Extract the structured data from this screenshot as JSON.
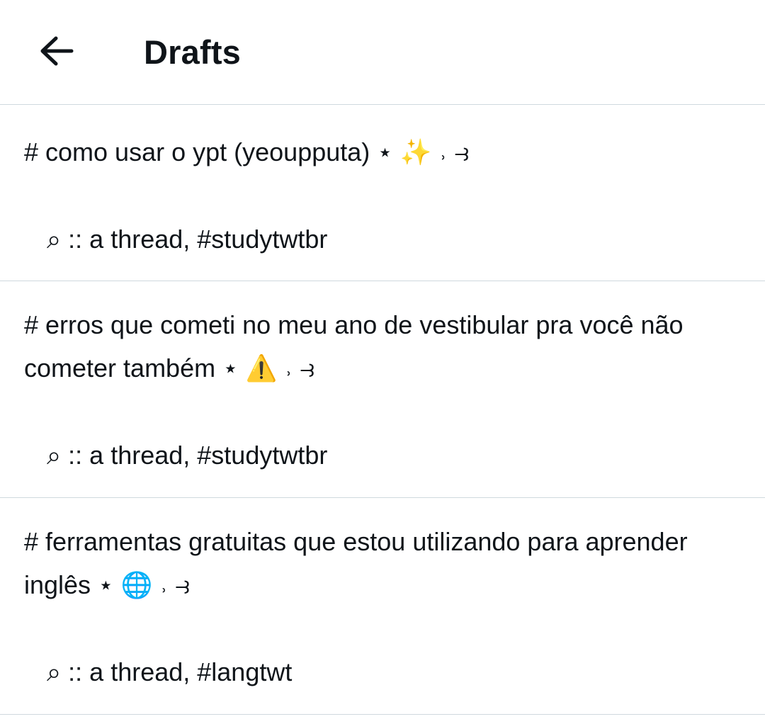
{
  "header": {
    "back_icon": "arrow-left-icon",
    "title": "Drafts"
  },
  "drafts": [
    {
      "lines": [
        "# como usar o ypt (yeoupputa) ⋆ ✨ ˒ ⥽"
      ],
      "subline": "⌕ :: a thread, #studytwtbr"
    },
    {
      "lines": [
        "# erros que cometi no meu ano de vestibular pra você não",
        "cometer também ⋆ ⚠️ ˒ ⥽"
      ],
      "subline": "⌕ :: a thread, #studytwtbr"
    },
    {
      "lines": [
        "# ferramentas gratuitas que estou utilizando para aprender",
        "inglês ⋆ 🌐 ˒ ⥽"
      ],
      "subline": "⌕ :: a thread, #langtwt"
    }
  ]
}
